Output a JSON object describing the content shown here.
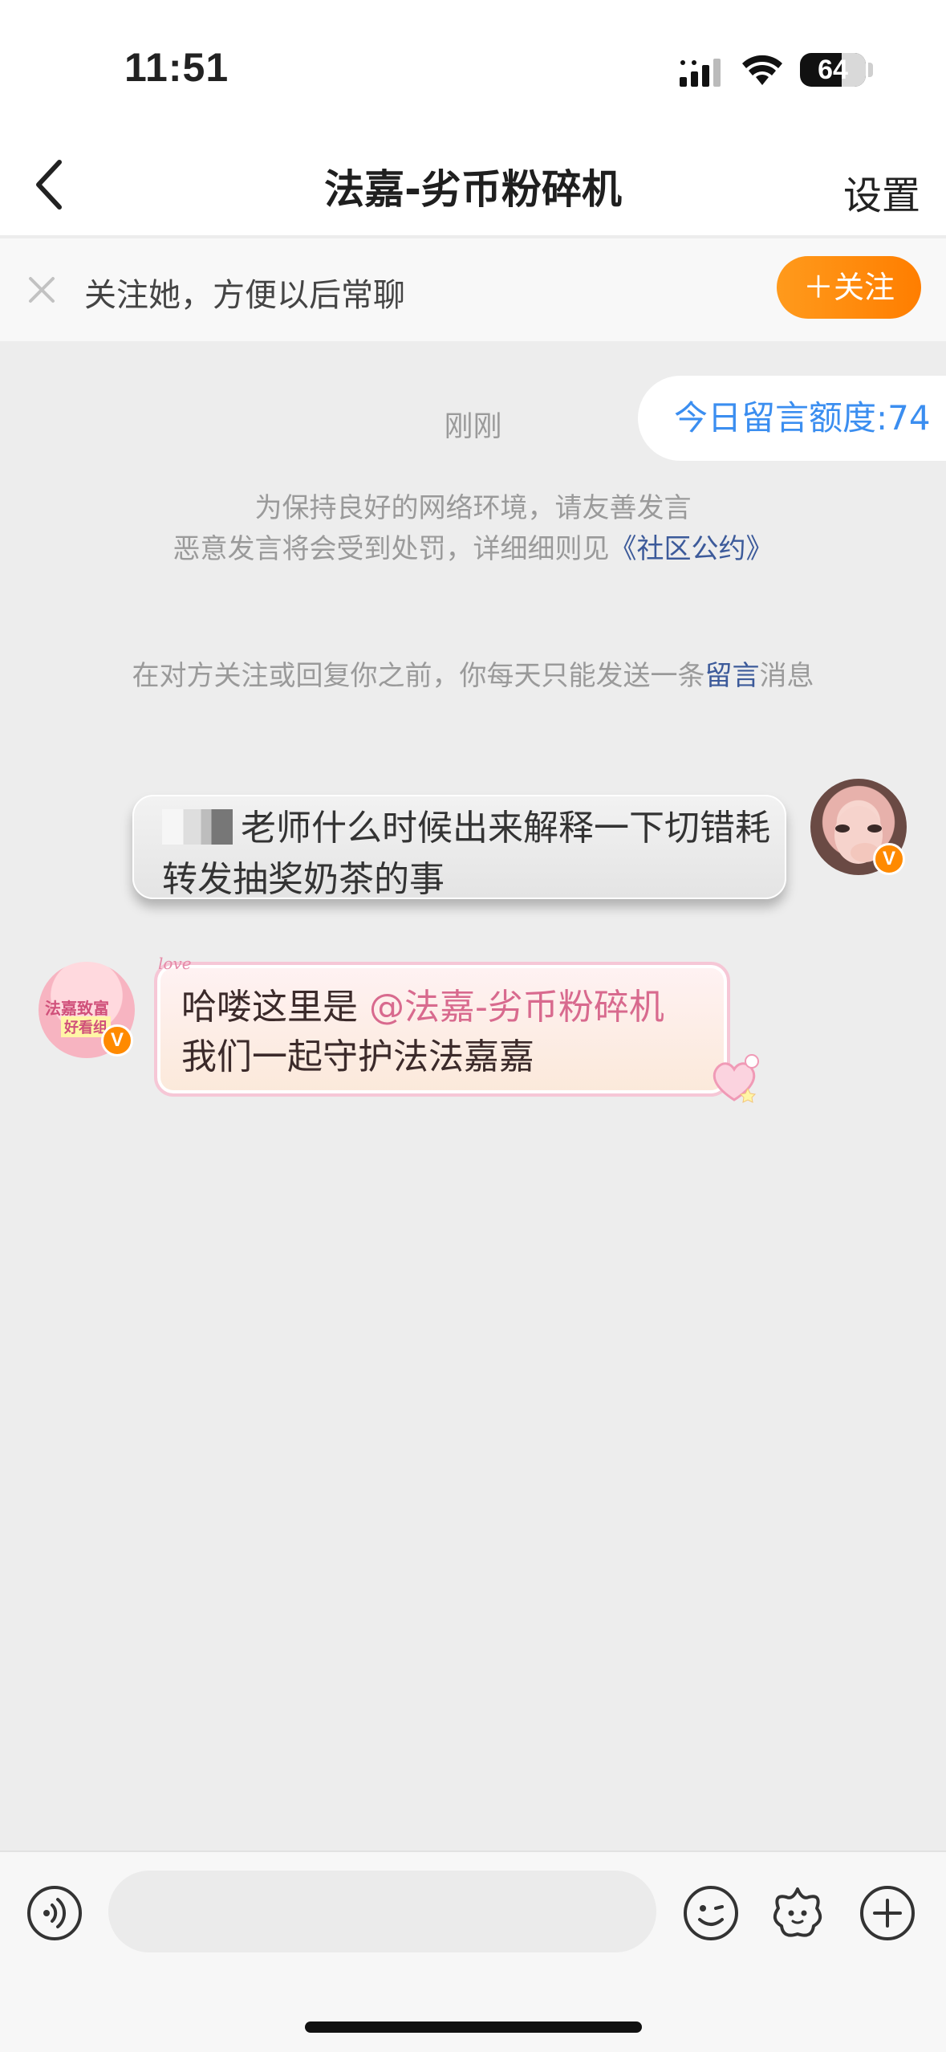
{
  "status_bar": {
    "time": "11:51",
    "battery": "64"
  },
  "nav": {
    "title": "法嘉-劣币粉碎机",
    "settings": "设置"
  },
  "follow_bar": {
    "text": "关注她，方便以后常聊",
    "button": "＋关注"
  },
  "quota": {
    "label": "今日留言额度:74"
  },
  "chat": {
    "timestamp": "刚刚",
    "notice_line1": "为保持良好的网络环境，请友善发言",
    "notice_line2_prefix": "恶意发言将会受到处罚，详细细则见",
    "notice_link": "《社区公约》",
    "limit_prefix": "在对方关注或回复你之前，你每天只能发送一条",
    "limit_link": "留言",
    "limit_suffix": "消息",
    "messages": [
      {
        "side": "right",
        "text": "老师什么时候出来解释一下切错耗转发抽奖奶茶的事"
      },
      {
        "side": "left",
        "text_prefix": "哈喽这里是 ",
        "mention": "@法嘉-劣币粉碎机",
        "text_line2": "我们一起守护法法嘉嘉"
      }
    ],
    "left_avatar_text": "法嘉致富",
    "left_avatar_text2": "好看组",
    "badge": "V",
    "love_tag": "love"
  },
  "colors": {
    "accent_orange": "#ff8a00",
    "link_blue": "#3b8ef0",
    "mention_pink": "#d86a8e"
  }
}
